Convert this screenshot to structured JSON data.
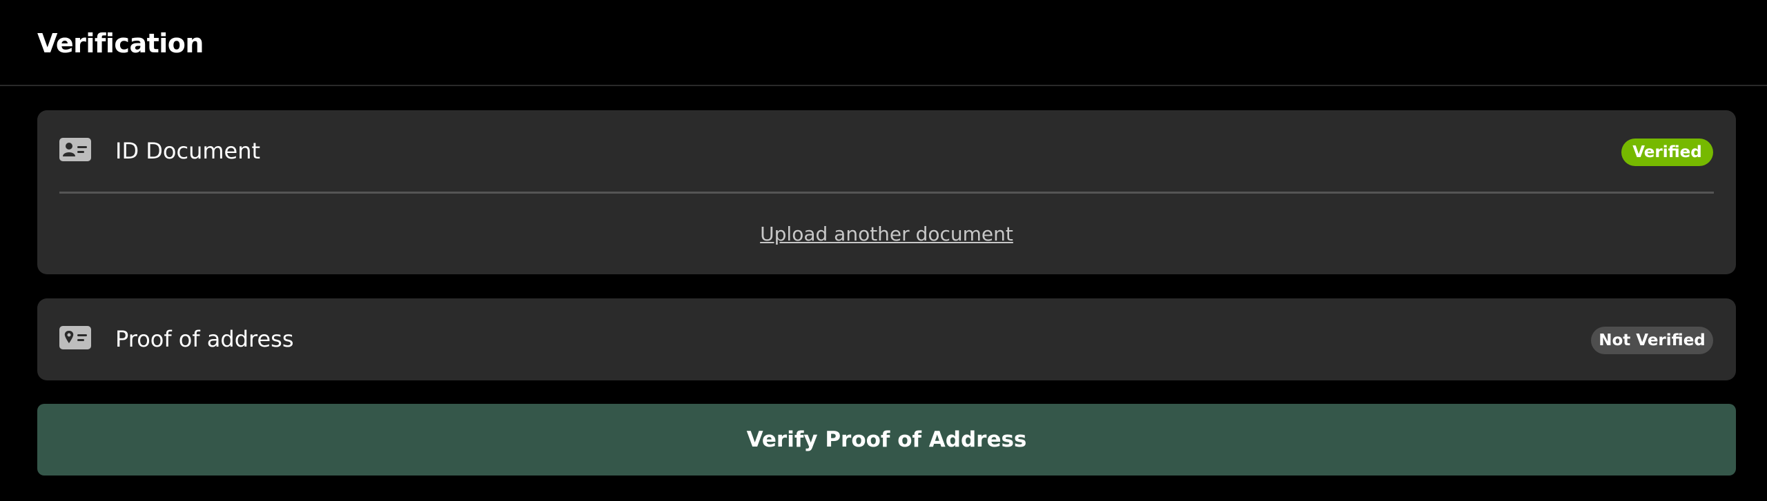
{
  "header": {
    "title": "Verification"
  },
  "id_card": {
    "icon": "id-card-icon",
    "label": "ID Document",
    "status": "Verified",
    "upload_link": "Upload another document"
  },
  "address_card": {
    "icon": "address-card-icon",
    "label": "Proof of address",
    "status": "Not Verified"
  },
  "actions": {
    "verify_label": "Verify Proof of Address"
  },
  "colors": {
    "background": "#000000",
    "card": "#2b2b2b",
    "verified_badge": "#76b900",
    "not_verified_badge": "#4e4e4e",
    "primary_button": "#35574a"
  }
}
